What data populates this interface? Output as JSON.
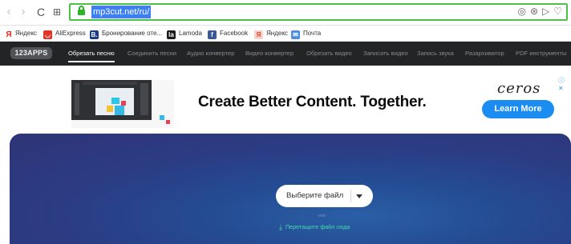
{
  "browser": {
    "url": "mp3cut.net/ru/"
  },
  "bookmarks": [
    {
      "label": "Яндекс",
      "icon": "yandex-icon",
      "color": "#e52620",
      "glyph": "Я"
    },
    {
      "label": "AliExpress",
      "icon": "aliexpress-icon",
      "color": "#e43225",
      "glyph": ""
    },
    {
      "label": "Бронирование оте...",
      "icon": "booking-icon",
      "color": "#1b3a84",
      "glyph": "B."
    },
    {
      "label": "Lamoda",
      "icon": "lamoda-icon",
      "color": "#1b1b1b",
      "glyph": "la"
    },
    {
      "label": "Facebook",
      "icon": "facebook-icon",
      "color": "#3b5998",
      "glyph": "f"
    },
    {
      "label": "Яндекс",
      "icon": "yandex-tab-icon",
      "color": "#f3c4b4",
      "glyph": "Я"
    },
    {
      "label": "Почта",
      "icon": "mail-icon",
      "color": "#4a8ce0",
      "glyph": "✉"
    }
  ],
  "appnav": {
    "logo": "123APPS",
    "items": [
      "Обрезать песню",
      "Соединить песни",
      "Аудио конвертер",
      "Видео конвертер",
      "Обрезать видео",
      "Записать видео",
      "Запись звука",
      "Разархиватор",
      "PDF инструменты"
    ],
    "active_index": 0
  },
  "ad": {
    "headline": "Create Better Content. Together.",
    "brand": "ceros",
    "cta": "Learn More",
    "adchoices": "ⓘ ✕"
  },
  "hero": {
    "choose_label": "Выберите файл",
    "or_label": "или",
    "drop_label": "Перетащите файл сюда"
  },
  "colors": {
    "accent_green": "#4bc248",
    "nav_bg": "#222425",
    "cta_blue": "#1a8cf2",
    "hero_blue": "#2f3477",
    "drop_green": "#49d9b0"
  }
}
